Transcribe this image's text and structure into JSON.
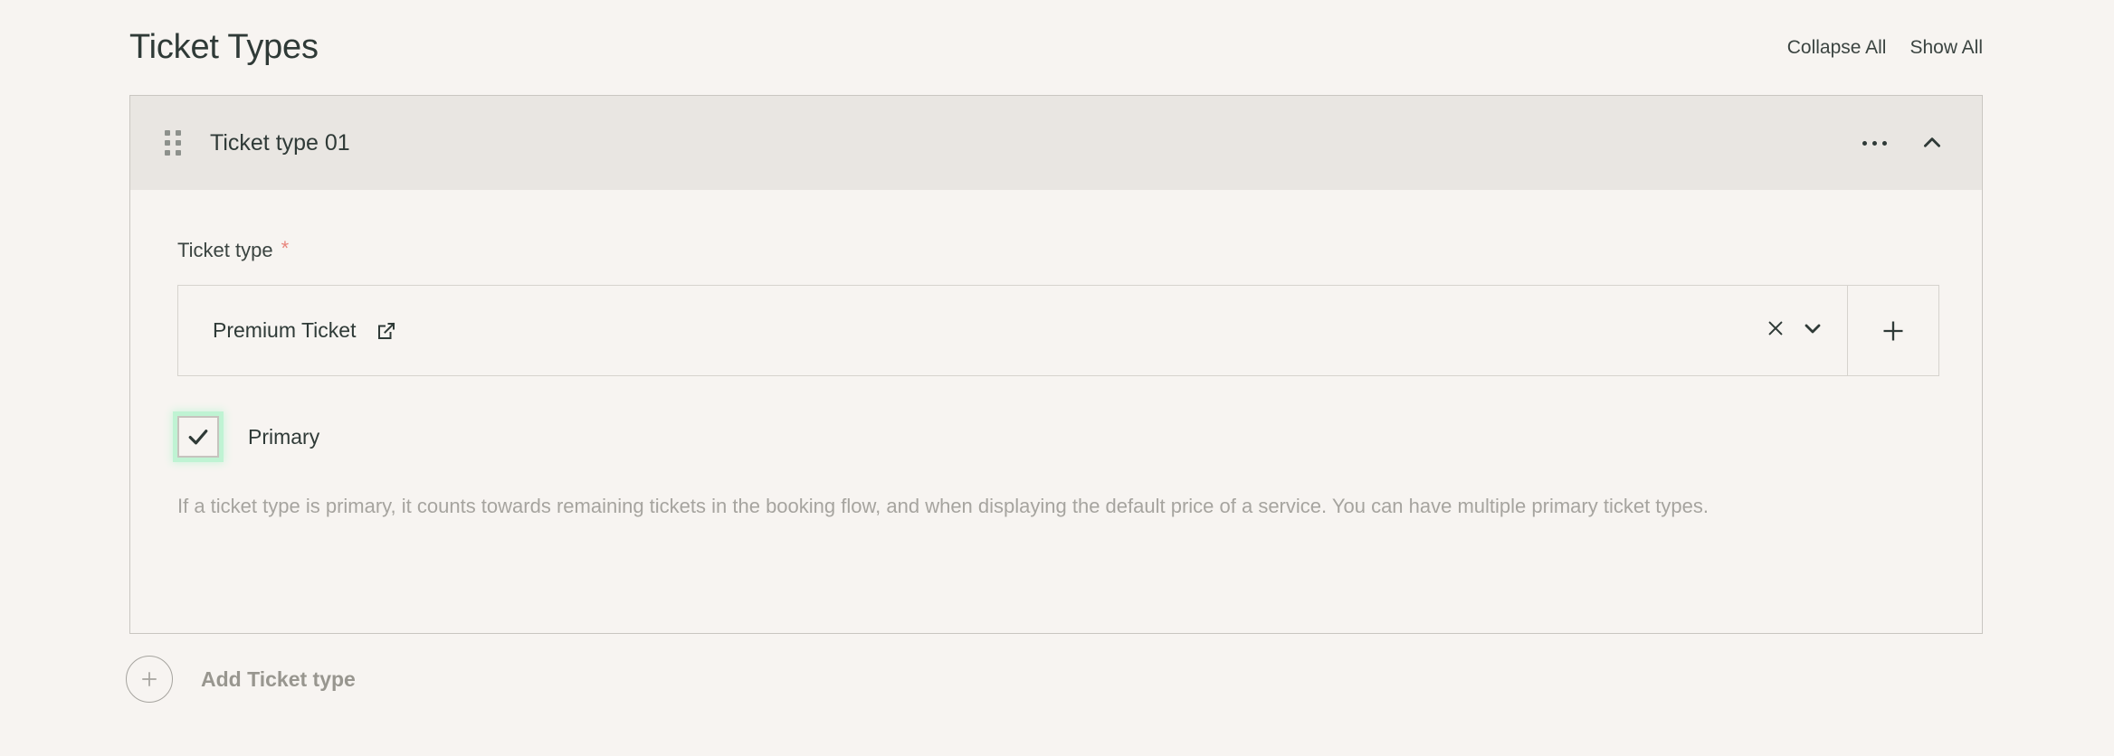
{
  "header": {
    "title": "Ticket Types",
    "actions": [
      {
        "label": "Collapse All",
        "name": "collapse-all-link"
      },
      {
        "label": "Show All",
        "name": "show-all-link"
      }
    ]
  },
  "card": {
    "title": "Ticket type 01",
    "drag_handle_icon": "drag-handle-icon",
    "menu_icon": "more-options-icon",
    "collapse_icon": "chevron-up-icon",
    "field": {
      "label": "Ticket type",
      "required_marker": "*",
      "value": "Premium Ticket",
      "edit_icon": "external-edit-icon",
      "clear_icon": "clear-icon",
      "dropdown_icon": "chevron-down-icon",
      "add_icon": "plus-icon"
    },
    "checkbox": {
      "label": "Primary",
      "checked": true,
      "check_icon": "checkmark-icon"
    },
    "help_text": "If a ticket type is primary, it counts towards remaining tickets in the booking flow, and when displaying the default price of a service. You can have multiple primary ticket types."
  },
  "add_row": {
    "label": "Add Ticket type",
    "icon": "plus-circle-icon"
  },
  "colors": {
    "background": "#f7f4f1",
    "card_header": "#e9e6e2",
    "border": "#c9c6c1",
    "text": "#2f3a37",
    "muted_text": "#a6a49f",
    "required_star": "#e8857c",
    "focus_ring": "#bff3d3"
  }
}
